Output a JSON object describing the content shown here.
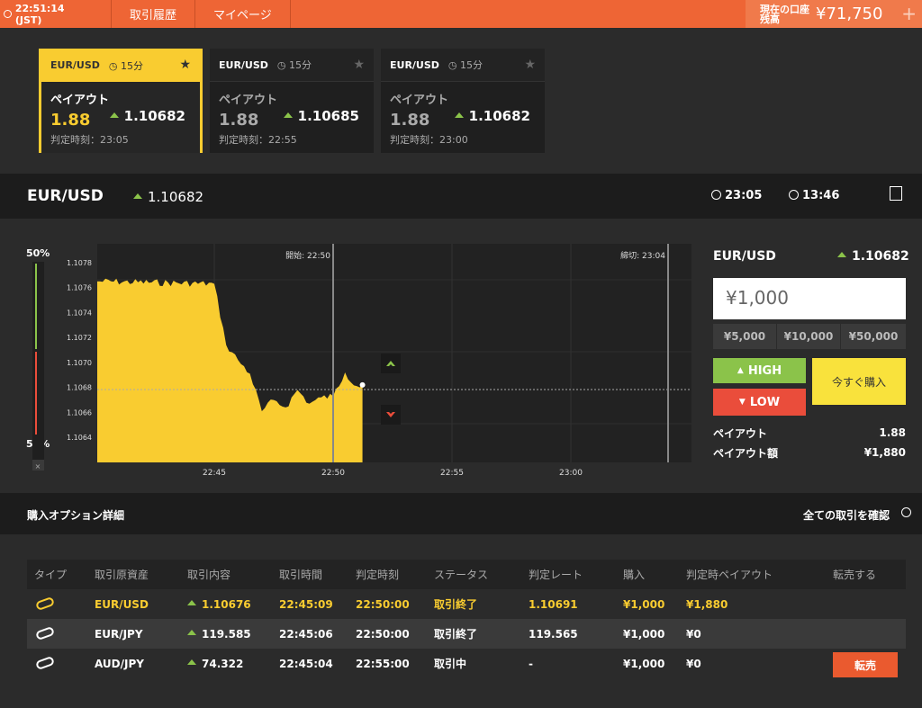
{
  "topbar": {
    "clock": "22:51:14 (JST)",
    "history": "取引履歴",
    "mypage": "マイページ",
    "balance_label": "現在の口座残高",
    "balance": "¥71,750",
    "plus": "+"
  },
  "cards": [
    {
      "pair": "EUR/USD",
      "time": "15分",
      "payout_label": "ペイアウト",
      "payout": "1.88",
      "rate": "1.10682",
      "judge": "判定時刻：23:05"
    },
    {
      "pair": "EUR/USD",
      "time": "15分",
      "payout_label": "ペイアウト",
      "payout": "1.88",
      "rate": "1.10685",
      "judge": "判定時刻：22:55"
    },
    {
      "pair": "EUR/USD",
      "time": "15分",
      "payout_label": "ペイアウト",
      "payout": "1.88",
      "rate": "1.10682",
      "judge": "判定時刻：23:00"
    }
  ],
  "band": {
    "pair": "EUR/USD",
    "rate": "1.10682",
    "close": "23:05",
    "remain": "13:46"
  },
  "chart": {
    "meter_top": "50%",
    "meter_bottom": "50%",
    "start_label": "開始: 22:50",
    "end_label": "締切: 23:04",
    "y_ticks": [
      "1.1078",
      "1.1076",
      "1.1074",
      "1.1072",
      "1.1070",
      "1.1068",
      "1.1066",
      "1.1064"
    ],
    "x_ticks": [
      "22:45",
      "22:50",
      "22:55",
      "23:00"
    ],
    "collapse": "×"
  },
  "chart_data": {
    "type": "area",
    "x": [
      "22:45",
      "22:45:30",
      "22:46",
      "22:46:30",
      "22:47",
      "22:47:30",
      "22:48",
      "22:48:30",
      "22:49",
      "22:49:30",
      "22:50",
      "22:50:30",
      "22:51",
      "22:51:14"
    ],
    "values": [
      1.10763,
      1.10714,
      1.10702,
      1.10691,
      1.10661,
      1.1067,
      1.10664,
      1.10678,
      1.10667,
      1.10672,
      1.10673,
      1.10692,
      1.10681,
      1.10682
    ],
    "ylim": [
      1.1062,
      1.1079
    ],
    "ylabel": "",
    "xlabel": "",
    "grid": true,
    "color": "#f9cc30"
  },
  "panel": {
    "pair": "EUR/USD",
    "rate": "1.10682",
    "amount": "¥1,000",
    "quick": [
      "¥5,000",
      "¥10,000",
      "¥50,000"
    ],
    "high": "HIGH",
    "low": "LOW",
    "buy": "今すぐ購入",
    "payout_label": "ペイアウト",
    "payout": "1.88",
    "payout_amt_label": "ペイアウト額",
    "payout_amt": "¥1,880"
  },
  "details": {
    "title": "購入オプション詳細",
    "all": "全ての取引を確認",
    "headers": [
      "タイプ",
      "取引原資産",
      "取引内容",
      "取引時間",
      "判定時刻",
      "ステータス",
      "判定レート",
      "購入",
      "判定時ペイアウト",
      "転売する"
    ],
    "rows": [
      {
        "asset": "EUR/USD",
        "content": "1.10676",
        "time": "22:45:09",
        "judge": "22:50:00",
        "status": "取引終了",
        "rate": "1.10691",
        "buy": "¥1,000",
        "payout": "¥1,880"
      },
      {
        "asset": "EUR/JPY",
        "content": "119.585",
        "time": "22:45:06",
        "judge": "22:50:00",
        "status": "取引終了",
        "rate": "119.565",
        "buy": "¥1,000",
        "payout": "¥0"
      },
      {
        "asset": "AUD/JPY",
        "content": "74.322",
        "time": "22:45:04",
        "judge": "22:55:00",
        "status": "取引中",
        "rate": "-",
        "buy": "¥1,000",
        "payout": "¥0",
        "sell": "転売"
      }
    ]
  }
}
